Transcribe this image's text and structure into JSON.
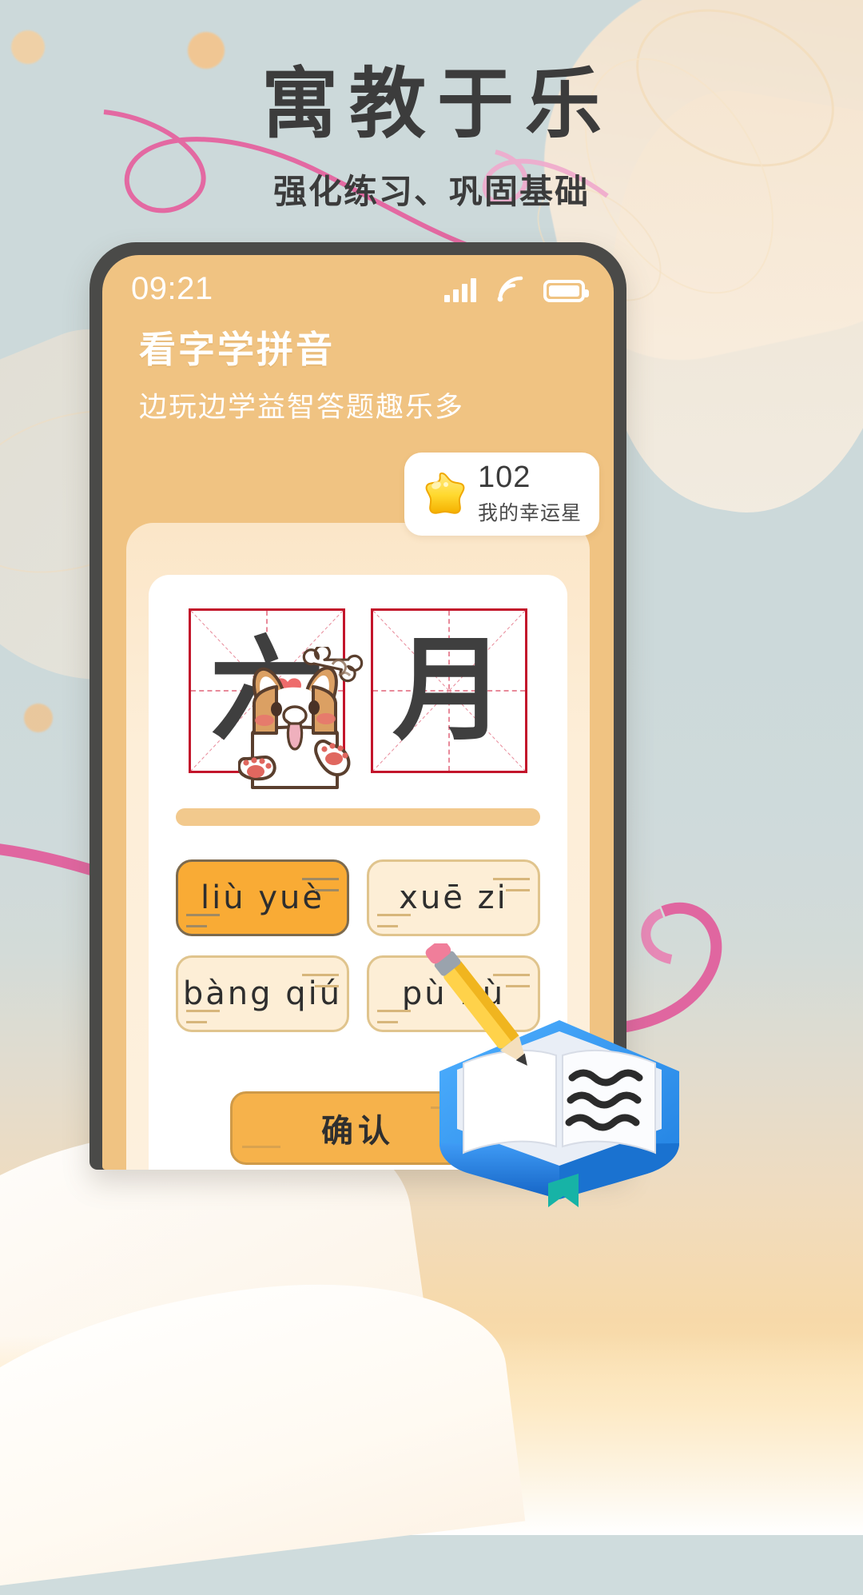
{
  "promo": {
    "headline": "寓教于乐",
    "subhead": "强化练习、巩固基础"
  },
  "phone": {
    "status": {
      "time": "09:21",
      "signal_icon": "signal-bars-icon",
      "wifi_icon": "wifi-icon",
      "battery_icon": "battery-icon"
    },
    "app": {
      "title": "看字学拼音",
      "tagline": "边玩边学益智答题趣乐多"
    },
    "star_badge": {
      "icon": "star-icon",
      "count": "102",
      "label": "我的幸运星"
    },
    "question": {
      "characters": [
        "六",
        "月"
      ]
    },
    "options": [
      {
        "label": "liù yuè",
        "selected": true
      },
      {
        "label": "xuē zi",
        "selected": false
      },
      {
        "label": "bàng qiú",
        "selected": false
      },
      {
        "label": "pù bù",
        "selected": false
      }
    ],
    "confirm_label": "确认"
  },
  "decor": {
    "mascot_icon": "corgi-dog-icon",
    "bone_icon": "bone-icon",
    "heart_icon": "heart-icon",
    "book_icon": "notebook-pencil-icon"
  },
  "colors": {
    "bg_top": "#ccd9da",
    "bg_bottom": "#ffffff",
    "phone_frame": "#4a4a48",
    "screen_header": "#f0c382",
    "accent_orange": "#f9ab35",
    "grid_red": "#c3152b",
    "ribbon_pink": "#e4639f",
    "headline_gray": "#3c3c3c"
  }
}
